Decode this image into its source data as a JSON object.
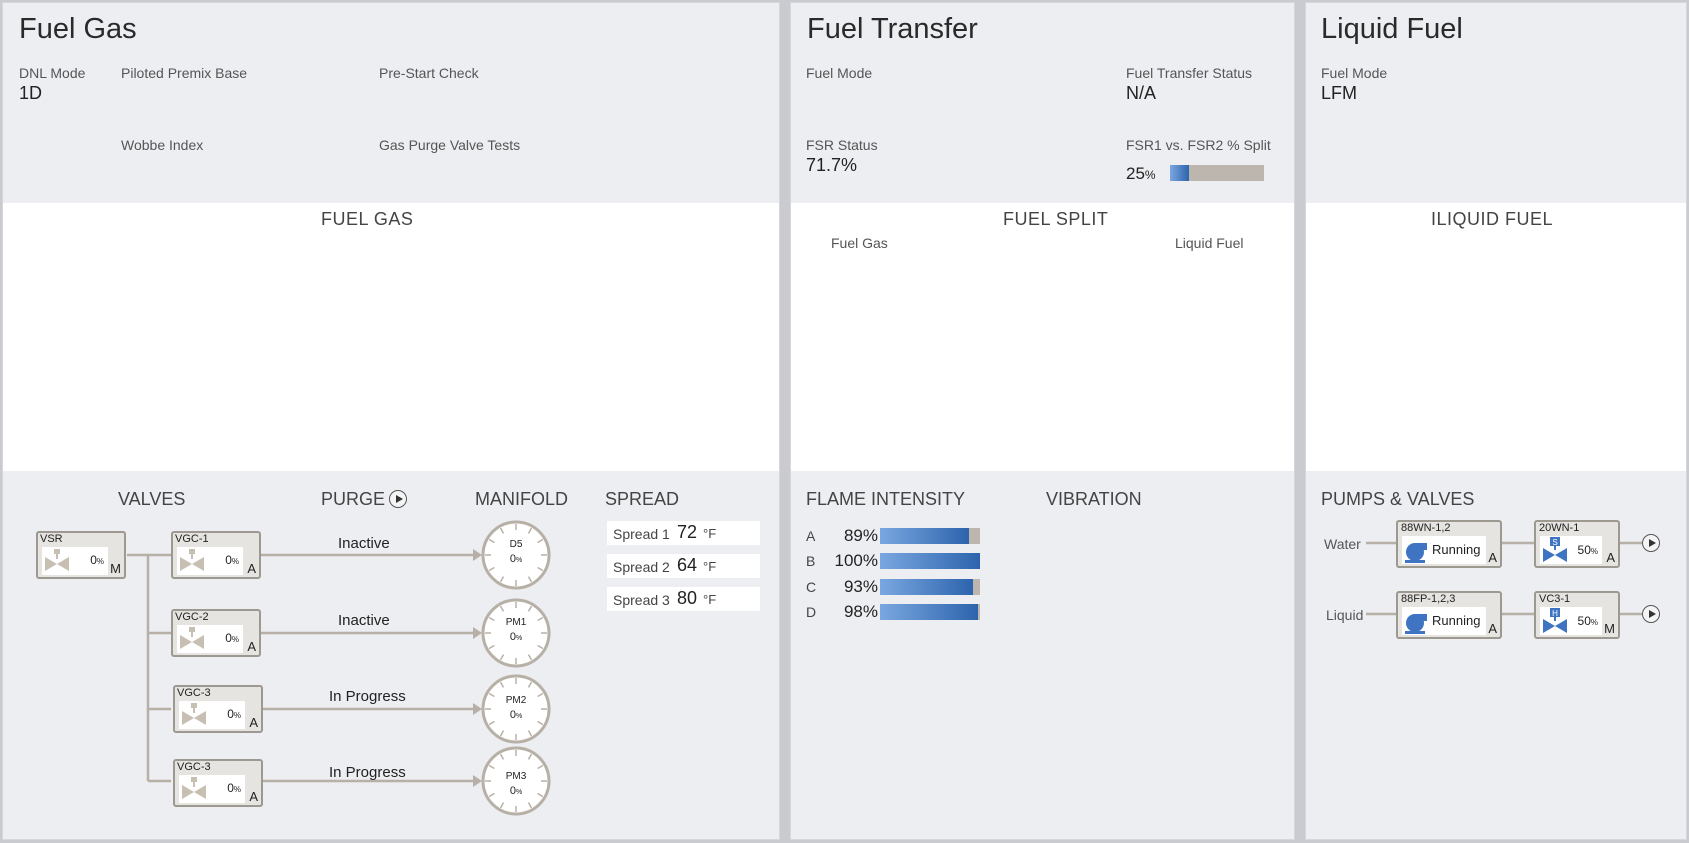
{
  "colors": {
    "panel": "#eceef2",
    "accent_blue": "#2d64ad",
    "pipe": "#b7b0a6",
    "bar_gray": "#bdb6ae"
  },
  "fuel_gas": {
    "title": "Fuel Gas",
    "dnl_mode_label": "DNL Mode",
    "dnl_mode_value": "1D",
    "piloted_premix_label": "Piloted Premix Base",
    "prestart_label": "Pre-Start Check",
    "wobbe_label": "Wobbe Index",
    "purge_tests_label": "Gas Purge Valve Tests",
    "section_title": "FUEL GAS",
    "valves_title": "VALVES",
    "purge_title": "PURGE",
    "manifold_title": "MANIFOLD",
    "spread_title": "SPREAD",
    "valves": [
      {
        "name": "VSR",
        "pct": "0",
        "unit": "%",
        "mode": "M",
        "icon": "gas-valve-icon"
      },
      {
        "name": "VGC-1",
        "pct": "0",
        "unit": "%",
        "mode": "A",
        "icon": "gas-valve-icon"
      },
      {
        "name": "VGC-2",
        "pct": "0",
        "unit": "%",
        "mode": "A",
        "icon": "gas-valve-icon"
      },
      {
        "name": "VGC-3",
        "pct": "0",
        "unit": "%",
        "mode": "A",
        "icon": "gas-valve-icon"
      },
      {
        "name": "VGC-3",
        "pct": "0",
        "unit": "%",
        "mode": "A",
        "icon": "gas-valve-icon"
      }
    ],
    "purge_status": [
      "Inactive",
      "Inactive",
      "In Progress",
      "In Progress"
    ],
    "manifolds": [
      {
        "name": "D5",
        "value": "0",
        "unit": "%"
      },
      {
        "name": "PM1",
        "value": "0",
        "unit": "%"
      },
      {
        "name": "PM2",
        "value": "0",
        "unit": "%"
      },
      {
        "name": "PM3",
        "value": "0",
        "unit": "%"
      }
    ],
    "spreads": [
      {
        "label": "Spread 1",
        "value": "72",
        "unit": "°F"
      },
      {
        "label": "Spread 2",
        "value": "64",
        "unit": "°F"
      },
      {
        "label": "Spread 3",
        "value": "80",
        "unit": "°F"
      }
    ]
  },
  "fuel_transfer": {
    "title": "Fuel Transfer",
    "fuel_mode_label": "Fuel Mode",
    "transfer_status_label": "Fuel Transfer Status",
    "transfer_status_value": "N/A",
    "fsr_status_label": "FSR Status",
    "fsr_status_value": "71.7%",
    "fsr_split_label": "FSR1 vs. FSR2 % Split",
    "fsr_split_value": "25",
    "fsr_split_unit": "%",
    "fsr_split_fraction": 0.2,
    "section_title": "FUEL SPLIT",
    "fuel_gas_label": "Fuel Gas",
    "liquid_fuel_label": "Liquid Fuel",
    "flame_title": "FLAME INTENSITY",
    "vibration_title": "VIBRATION",
    "flame": [
      {
        "label": "A",
        "value": "89%",
        "fraction": 0.89
      },
      {
        "label": "B",
        "value": "100%",
        "fraction": 1.0
      },
      {
        "label": "C",
        "value": "93%",
        "fraction": 0.93
      },
      {
        "label": "D",
        "value": "98%",
        "fraction": 0.98
      }
    ]
  },
  "liquid_fuel": {
    "title": "Liquid Fuel",
    "fuel_mode_label": "Fuel Mode",
    "fuel_mode_value": "LFM",
    "section_title": "ILIQUID FUEL",
    "pumps_title": "PUMPS & VALVES",
    "lines": [
      {
        "label": "Water",
        "pump_name": "88WN-1,2",
        "pump_state": "Running",
        "pump_mode": "A",
        "valve_name": "20WN-1",
        "valve_pct": "50",
        "valve_unit": "%",
        "valve_mode": "A",
        "valve_letter": "S"
      },
      {
        "label": "Liquid",
        "pump_name": "88FP-1,2,3",
        "pump_state": "Running",
        "pump_mode": "A",
        "valve_name": "VC3-1",
        "valve_pct": "50",
        "valve_unit": "%",
        "valve_mode": "M",
        "valve_letter": "H"
      }
    ]
  }
}
